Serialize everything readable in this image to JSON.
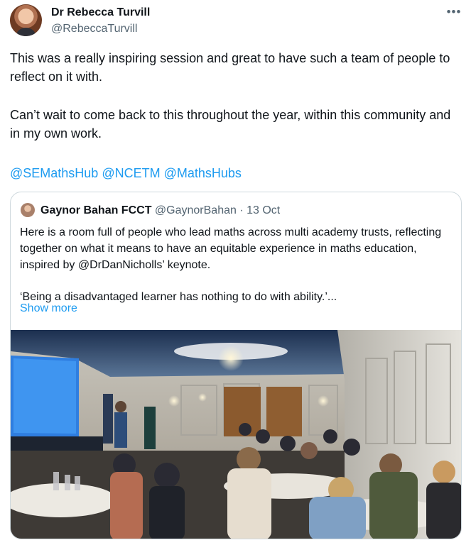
{
  "tweet": {
    "author_name": "Dr Rebecca Turvill",
    "author_handle": "@RebeccaTurvill",
    "more_icon": "•••",
    "paragraph1": "This was a really inspiring session and great to have such a team of people to reflect on it with.",
    "paragraph2": "Can’t wait to come back to this throughout the year, within this community and in my own work.",
    "mentions": [
      "@SEMathsHub",
      "@NCETM",
      "@MathsHubs"
    ]
  },
  "quote": {
    "author_name": "Gaynor Bahan FCCT",
    "meta": "@GaynorBahan · 13 Oct",
    "text1": "Here is a room full of people who lead maths across multi academy trusts, reflecting together on what it means to have an equitable experience in maths education, inspired by @DrDanNicholls’ keynote.",
    "text2": "‘Being a disadvantaged learner has nothing to do with ability.’...",
    "show_more": "Show more"
  },
  "colors": {
    "link": "#1d9bf0",
    "secondary_text": "#536471",
    "border": "#cfd9de"
  }
}
